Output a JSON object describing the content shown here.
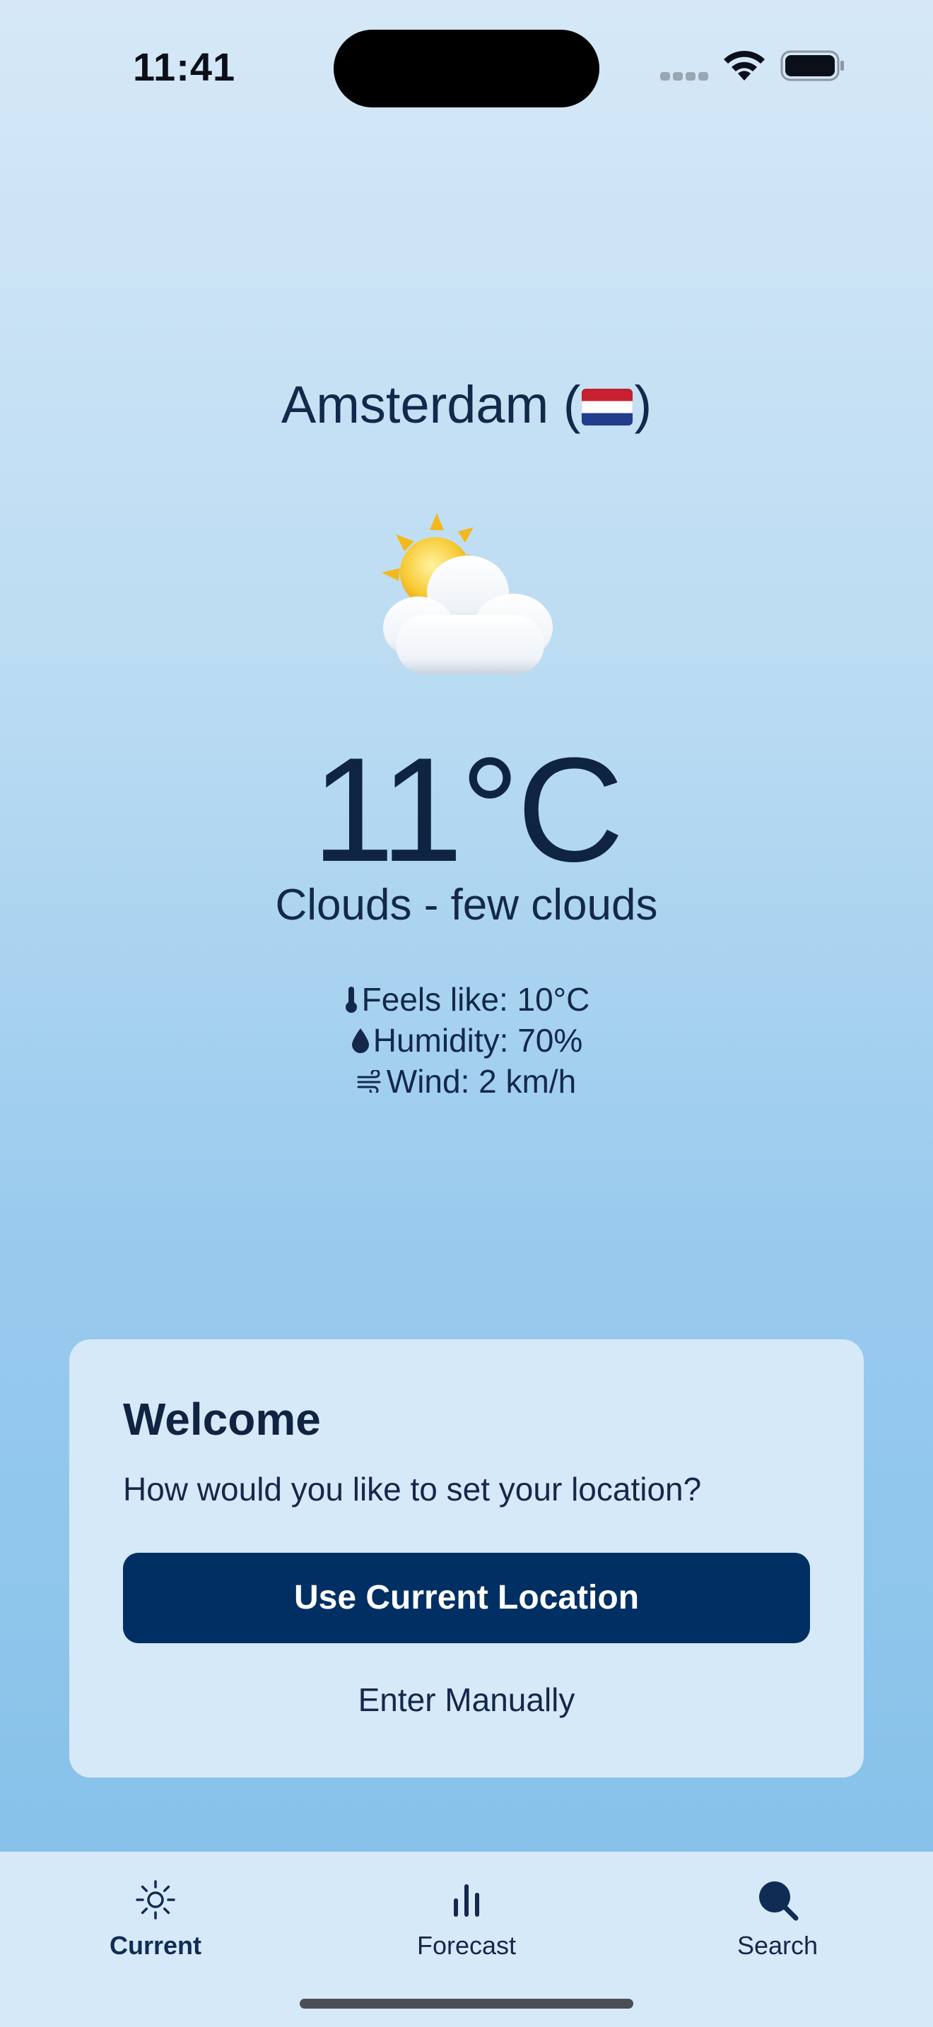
{
  "status_bar": {
    "time": "11:41"
  },
  "weather": {
    "city": "Amsterdam",
    "country_flag": "netherlands-flag",
    "icon": "sun-behind-cloud-icon",
    "temperature": "11°C",
    "description": "Clouds - few clouds",
    "details": [
      {
        "icon": "thermometer-icon",
        "text": "Feels like: 10°C"
      },
      {
        "icon": "droplet-icon",
        "text": "Humidity: 70%"
      },
      {
        "icon": "wind-icon",
        "text": "Wind: 2 km/h"
      }
    ]
  },
  "welcome_card": {
    "title": "Welcome",
    "question": "How would you like to set your location?",
    "primary_button": "Use Current Location",
    "secondary_button": "Enter Manually"
  },
  "tab_bar": {
    "tabs": [
      {
        "label": "Current",
        "icon": "sun-icon",
        "active": true
      },
      {
        "label": "Forecast",
        "icon": "bar-chart-icon",
        "active": false
      },
      {
        "label": "Search",
        "icon": "search-icon",
        "active": false
      }
    ]
  },
  "colors": {
    "primary": "#003063",
    "text": "#13284a",
    "card_background": "#d6e9f8",
    "gradient_top": "#d6e8f7",
    "gradient_bottom": "#82bfe8"
  }
}
